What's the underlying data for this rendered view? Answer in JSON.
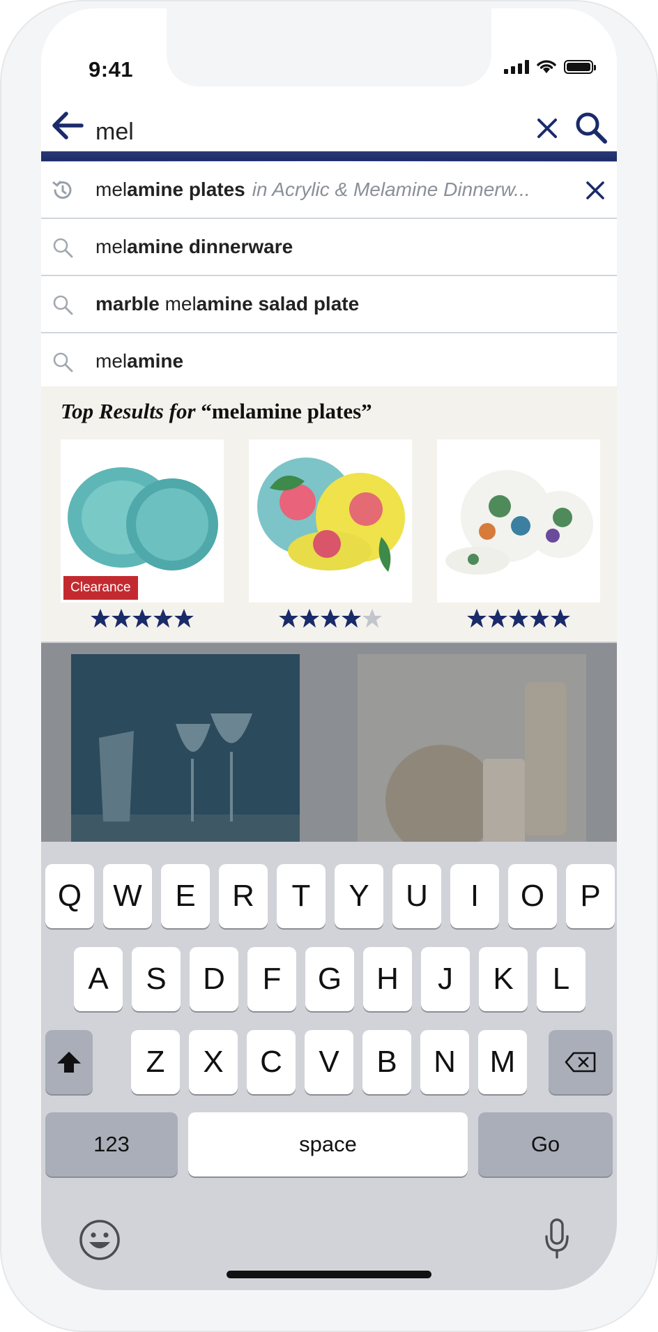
{
  "status": {
    "time": "9:41"
  },
  "search": {
    "query": "mel"
  },
  "suggestions": [
    {
      "type": "history",
      "prefix": "mel",
      "bold": "amine plates",
      "context": "in Acrylic & Melamine Dinnerw..."
    },
    {
      "type": "search",
      "prefix": "mel",
      "bold": "amine dinnerware"
    },
    {
      "type": "search",
      "lead_bold": "marble",
      "prefix": " mel",
      "bold": "amine salad plate"
    },
    {
      "type": "search",
      "prefix": "mel",
      "bold": "amine"
    }
  ],
  "top_results": {
    "title_italic": "Top Results for",
    "title_query": "“melamine plates”",
    "products": [
      {
        "name": "Turquoise melamine plates",
        "badge": "Clearance",
        "rating": 5
      },
      {
        "name": "Floral melamine dinnerware",
        "rating": 4
      },
      {
        "name": "Succulent melamine dinnerware",
        "rating": 5
      }
    ]
  },
  "keyboard": {
    "row1": [
      "Q",
      "W",
      "E",
      "R",
      "T",
      "Y",
      "U",
      "I",
      "O",
      "P"
    ],
    "row2": [
      "A",
      "S",
      "D",
      "F",
      "G",
      "H",
      "J",
      "K",
      "L"
    ],
    "row3": [
      "Z",
      "X",
      "C",
      "V",
      "B",
      "N",
      "M"
    ],
    "numbers_label": "123",
    "space_label": "space",
    "go_label": "Go"
  },
  "colors": {
    "brand_navy": "#1a2b6a",
    "clearance_red": "#c32a2f",
    "star_empty": "#c3c5cc"
  }
}
